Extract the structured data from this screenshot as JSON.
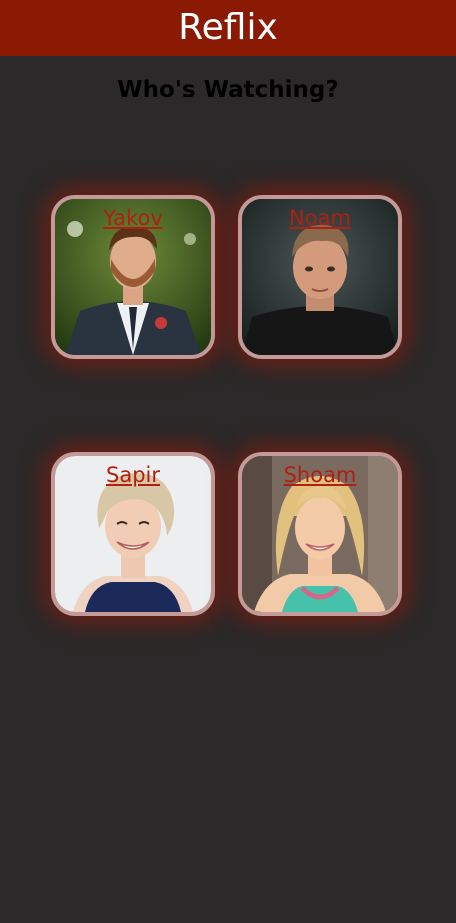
{
  "header": {
    "title": "Reflix"
  },
  "main": {
    "title": "Who's Watching?",
    "profiles": [
      {
        "name": "Yakov"
      },
      {
        "name": "Noam"
      },
      {
        "name": "Sapir"
      },
      {
        "name": "Shoam"
      }
    ]
  },
  "colors": {
    "header_bg": "#8a1a04",
    "page_bg": "#2b2929",
    "name_link": "#b01f10",
    "card_border": "#c49a98"
  }
}
